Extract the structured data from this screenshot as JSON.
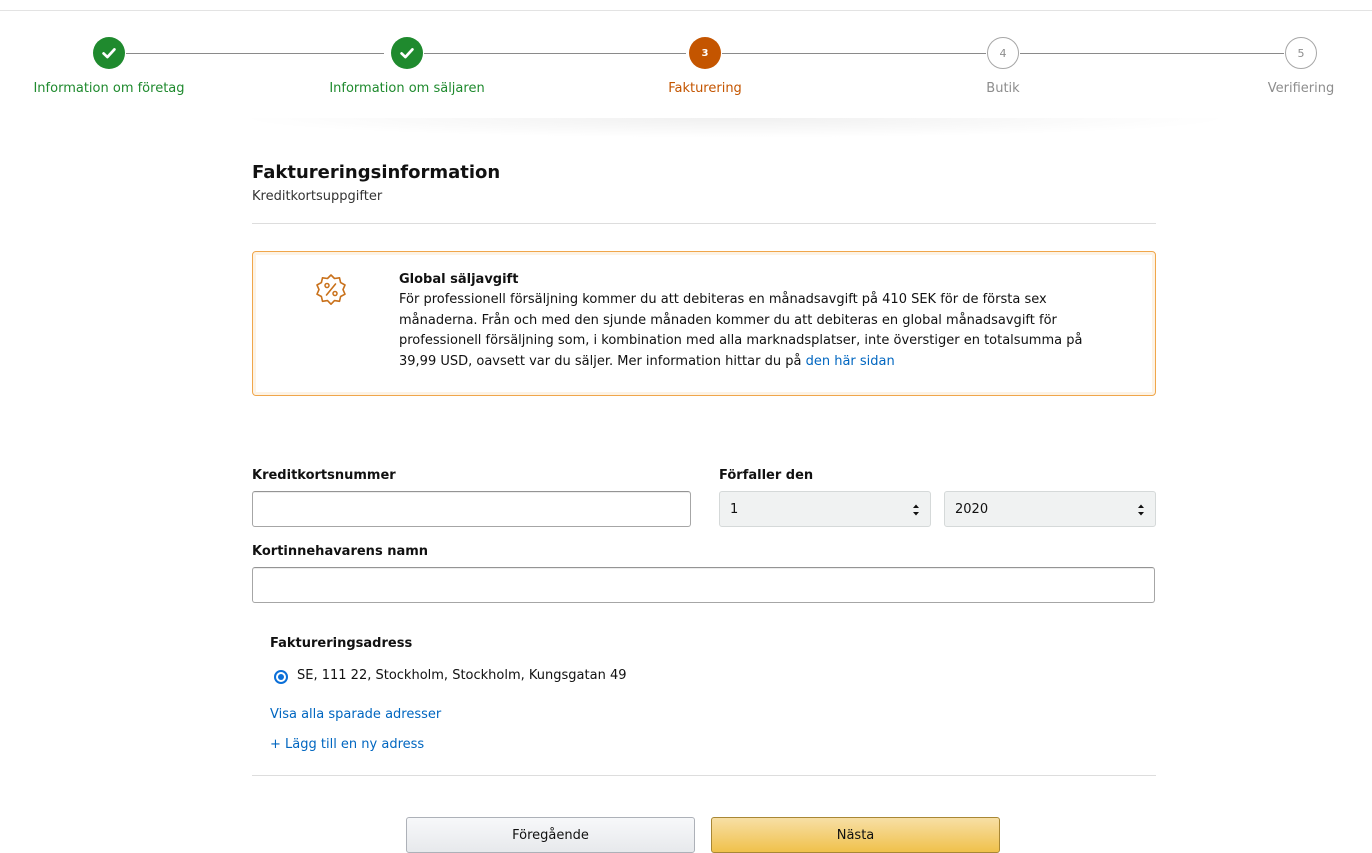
{
  "stepper": {
    "steps": [
      {
        "number": "1",
        "label": "Information om företag",
        "state": "done"
      },
      {
        "number": "2",
        "label": "Information om säljaren",
        "state": "done"
      },
      {
        "number": "3",
        "label": "Fakturering",
        "state": "current"
      },
      {
        "number": "4",
        "label": "Butik",
        "state": "todo"
      },
      {
        "number": "5",
        "label": "Verifiering",
        "state": "todo"
      }
    ],
    "colors": {
      "done": "#1f8a2e",
      "current": "#c45500",
      "todo": "#8d8d8d"
    }
  },
  "header": {
    "title": "Faktureringsinformation",
    "subtitle": "Kreditkortsuppgifter"
  },
  "alert": {
    "icon": "percent-badge-icon",
    "title": "Global säljavgift",
    "body": "För professionell försäljning kommer du att debiteras en månadsavgift på 410 SEK för de första sex månaderna. Från och med den sjunde månaden kommer du att debiteras en global månadsavgift för professionell försäljning som, i kombination med alla marknadsplatser, inte överstiger en totalsumma på 39,99 USD, oavsett var du säljer. Mer information hittar du på",
    "link_text": "den här sidan",
    "border_color": "#f0a64a"
  },
  "form": {
    "card_number": {
      "label": "Kreditkortsnummer",
      "value": ""
    },
    "expiry": {
      "label": "Förfaller den",
      "month": "1",
      "year": "2020"
    },
    "cardholder": {
      "label": "Kortinnehavarens namn",
      "value": ""
    }
  },
  "billing": {
    "heading": "Faktureringsadress",
    "selected_address": "SE, 111 22, Stockholm, Stockholm, Kungsgatan 49",
    "show_all_link": "Visa alla sparade adresser",
    "add_new_link": "+ Lägg till en ny adress"
  },
  "footer": {
    "previous_label": "Föregående",
    "next_label": "Nästa"
  }
}
